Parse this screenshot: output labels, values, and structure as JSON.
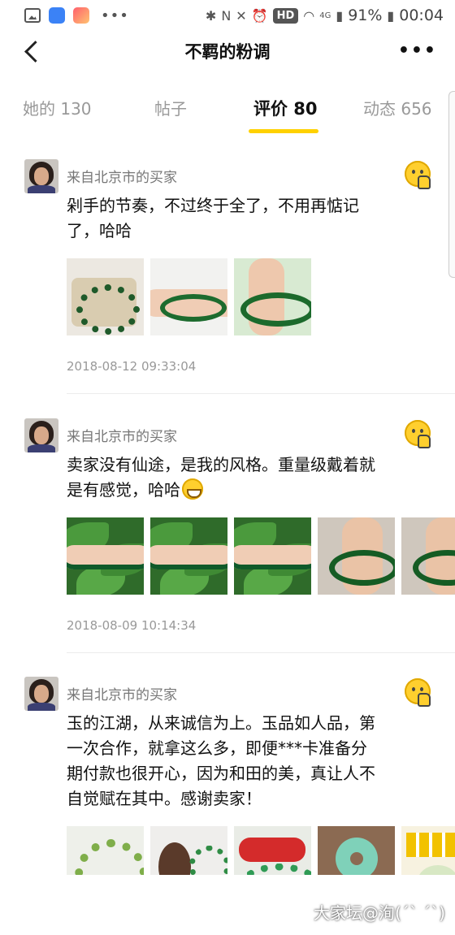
{
  "status_bar": {
    "hd": "HD",
    "battery": "91%",
    "time": "00:04",
    "signal": "4G"
  },
  "header": {
    "title": "不羁的粉调"
  },
  "tabs": [
    {
      "label": "她的 130",
      "active": false
    },
    {
      "label": "帖子",
      "active": false
    },
    {
      "label": "评价 80",
      "active": true
    },
    {
      "label": "动态 656",
      "active": false
    }
  ],
  "reviews": [
    {
      "reviewer": "来自北京市的买家",
      "text_lines": [
        "剁手的节奏，不过终于全了，不用再惦记",
        "了，哈哈"
      ],
      "date": "2018-08-12 09:33:04",
      "photo_count": 3
    },
    {
      "reviewer": "来自北京市的买家",
      "text_lines": [
        "卖家没有仙途，是我的风格。重量级戴着就",
        "是有感觉，哈哈"
      ],
      "date": "2018-08-09 10:14:34",
      "photo_count": 5
    },
    {
      "reviewer": "来自北京市的买家",
      "text_lines": [
        "玉的江湖，从来诚信为上。玉品如人品，第",
        "一次合作，就拿这么多，即便***卡准备分",
        "期付款也很开心，因为和田的美，真让人不",
        "自觉赋在其中。感谢卖家！"
      ],
      "photo_count": 5
    }
  ],
  "watermark": "大家坛@洵(ˊˋ ˊˋ)",
  "colors": {
    "accent": "#ffd100",
    "muted_text": "#999999"
  },
  "icons": [
    "photo-icon",
    "globe-icon",
    "app-icon",
    "back-icon",
    "more-icon",
    "thumbs-up-emoji-icon",
    "grin-emoji-icon"
  ]
}
